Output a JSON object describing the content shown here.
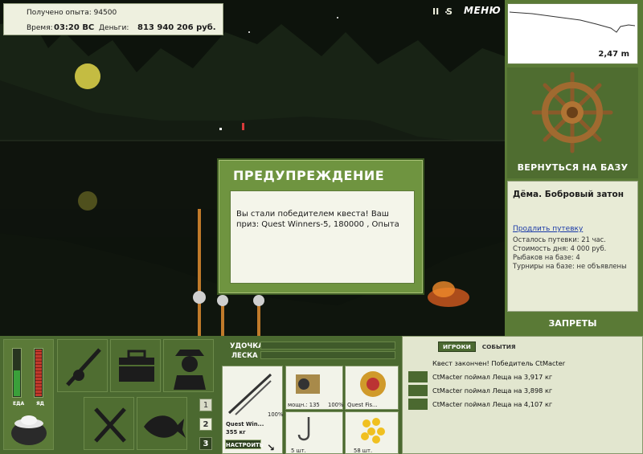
{
  "hud": {
    "experience_text": "Получено опыта: 94500",
    "time_label": "Время:",
    "time_value": "03:20 ВС",
    "money_label": "Деньги:",
    "money_value": "813 940 206 руб."
  },
  "toolbar": {
    "pause_glyph": "II",
    "sound_glyph": "S",
    "menu_label": "МЕНЮ"
  },
  "depth_panel": {
    "depth_value": "2,47 m"
  },
  "base": {
    "return_label": "ВЕРНУТЬСЯ НА БАЗУ",
    "location_name": "Дёма. Бобровый затон",
    "extend_link": "Продлить путевку",
    "remaining": "Осталось путевки: 21 час.",
    "day_cost": "Стоимость дня: 4 000 руб.",
    "anglers": "Рыбаков на базе: 4",
    "tournaments": "Турниры на базе: не объявлены",
    "bans_label": "ЗАПРЕТЫ"
  },
  "dialog": {
    "title": "ПРЕДУПРЕЖДЕНИЕ",
    "message": "Вы стали победителем квеста! Ваш приз: Quest Winners-5, 180000 , Опыта"
  },
  "meters": {
    "food_label": "ЕДА",
    "poison_label": "ЯД",
    "food_level": 0.55,
    "poison_level": 1.0
  },
  "slots": {
    "numbers": [
      "1",
      "2",
      "3"
    ]
  },
  "tackle": {
    "rod_label": "УДОЧКА",
    "line_label": "ЛЕСКА",
    "rod_name": "Quest Win...",
    "rod_weight": "355 кг",
    "rod_percent": "100%",
    "reel_text": "мощн.: 135",
    "reel_percent": "100%",
    "line_name": "Quest Fis...",
    "hook_count": "5 шт.",
    "bait_count": "58 шт.",
    "setup_label": "НАСТРОИТЬ"
  },
  "chat": {
    "tab_players": "ИГРОКИ",
    "tab_events": "СОБЫТИЯ",
    "messages": [
      "Квест закончен! Победитель CtMacter",
      "CtMacter поймал Леща на 3,917 кг",
      "CtMacter поймал Леща на 3,898 кг",
      "CtMacter поймал Леща на 4,107 кг"
    ]
  },
  "colors": {
    "panel_green": "#4b6930",
    "accent_green": "#6f9440",
    "food_bar": "#3aa03a",
    "poison_bar": "#c0392b"
  }
}
